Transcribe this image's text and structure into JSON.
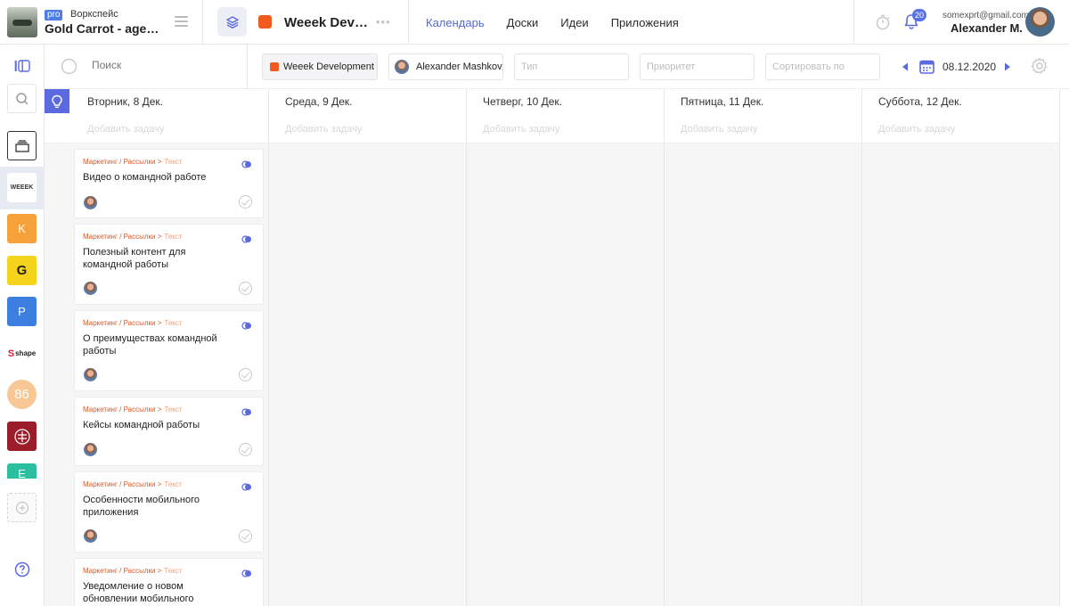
{
  "workspace": {
    "badge": "pro",
    "label": "Воркспейс",
    "name": "Gold Carrot - age…"
  },
  "project": {
    "name": "Weeek Dev…",
    "color": "#f0591f"
  },
  "nav": {
    "tabs": [
      {
        "label": "Календарь",
        "active": true
      },
      {
        "label": "Доски",
        "active": false
      },
      {
        "label": "Идеи",
        "active": false
      },
      {
        "label": "Приложения",
        "active": false
      }
    ]
  },
  "user": {
    "email": "somexprt@gmail.com",
    "name": "Alexander M.",
    "notifications": "20"
  },
  "rail": {
    "items": [
      {
        "name": "rail-workspace-weeek",
        "label": "WEEEK",
        "bg": "#ffffff",
        "fg": "#333333"
      },
      {
        "name": "rail-workspace-k",
        "label": "K",
        "bg": "#f7a13a",
        "fg": "#ffffff"
      },
      {
        "name": "rail-workspace-g",
        "label": "G",
        "bg": "#f5d31b",
        "fg": "#222222"
      },
      {
        "name": "rail-workspace-p",
        "label": "P",
        "bg": "#3d7fe0",
        "fg": "#ffffff"
      },
      {
        "name": "rail-workspace-shape",
        "label": "shape",
        "bg": "#ffffff",
        "fg": "#222222"
      },
      {
        "name": "rail-workspace-86",
        "label": "86",
        "bg": "#f7c896",
        "fg": "#ffffff"
      },
      {
        "name": "rail-workspace-crest",
        "label": "",
        "bg": "#9b1d2a",
        "fg": "#ffffff"
      },
      {
        "name": "rail-workspace-e",
        "label": "E",
        "bg": "#2cbf9f",
        "fg": "#ffffff"
      }
    ]
  },
  "filters": {
    "search_placeholder": "Поиск",
    "project_chip": "Weeek Development",
    "user_chip": "Alexander Mashkov",
    "type_placeholder": "Тип",
    "priority_placeholder": "Приоритет",
    "sort_placeholder": "Сортировать по",
    "date": "08.12.2020"
  },
  "calendar": {
    "add_task_label": "Добавить задачу",
    "days": [
      {
        "label": "Вторник, 8 Дек."
      },
      {
        "label": "Среда, 9 Дек."
      },
      {
        "label": "Четверг, 10 Дек."
      },
      {
        "label": "Пятница, 11 Дек."
      },
      {
        "label": "Суббота, 12 Дек."
      }
    ],
    "cards": [
      {
        "path": "Маркетинг / Рассылки >",
        "tag": "Текст",
        "title": "Видео о командной работе"
      },
      {
        "path": "Маркетинг / Рассылки >",
        "tag": "Текст",
        "title": "Полезный контент для командной работы"
      },
      {
        "path": "Маркетинг / Рассылки >",
        "tag": "Текст",
        "title": "О преимуществах командной работы"
      },
      {
        "path": "Маркетинг / Рассылки >",
        "tag": "Текст",
        "title": "Кейсы командной работы"
      },
      {
        "path": "Маркетинг / Рассылки >",
        "tag": "Текст",
        "title": "Особенности мобильного приложения"
      },
      {
        "path": "Маркетинг / Рассылки >",
        "tag": "Текст",
        "title": "Уведомление о новом обновлении мобильного"
      }
    ]
  }
}
